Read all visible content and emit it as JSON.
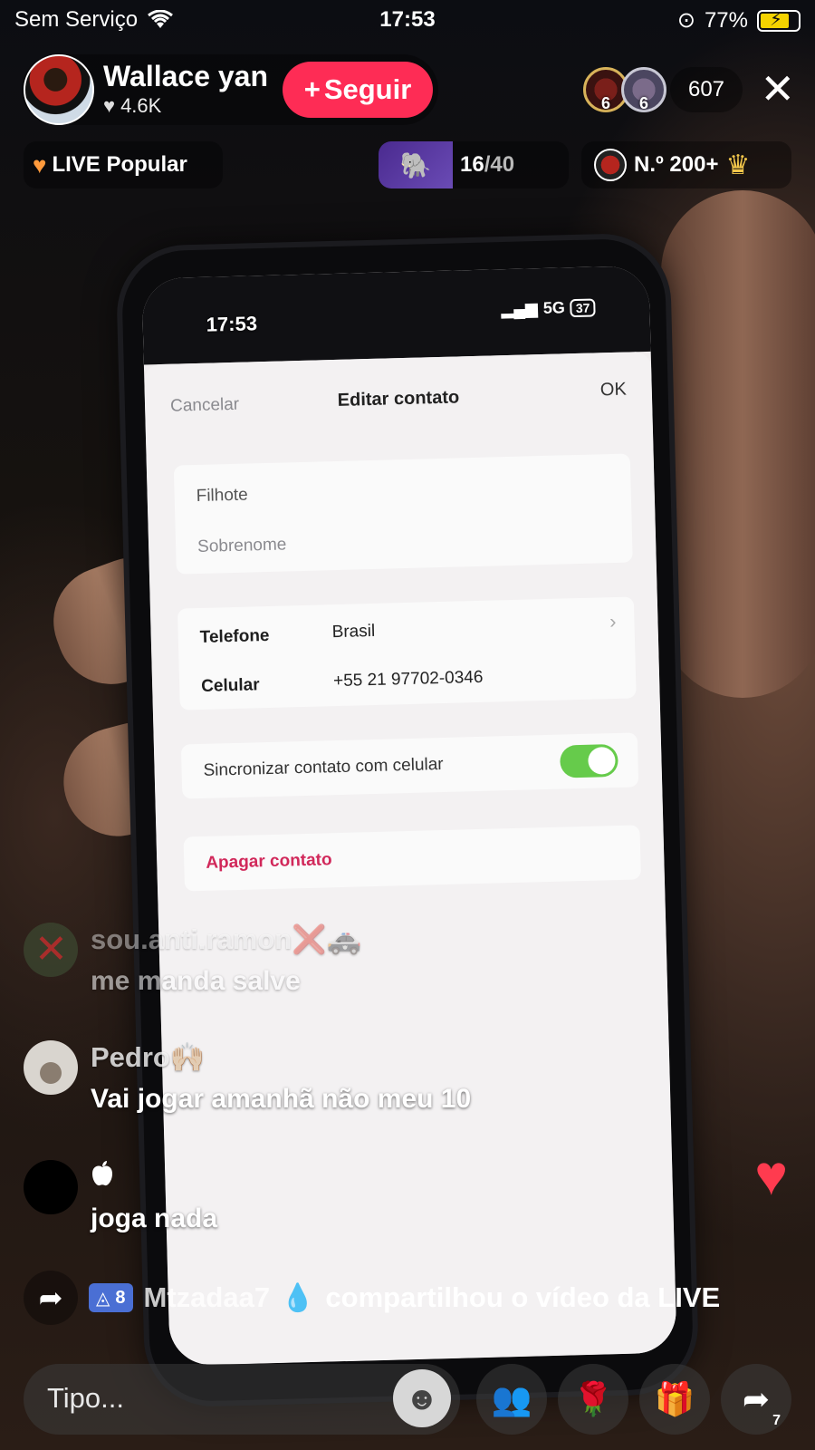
{
  "status_bar": {
    "carrier": "Sem Serviço",
    "time": "17:53",
    "battery": "77%"
  },
  "host": {
    "name": "Wallace yan",
    "likes": "4.6K",
    "follow_label": "Seguir"
  },
  "viewers": {
    "top1_rank": "6",
    "top2_rank": "6",
    "count": "607"
  },
  "badges": {
    "popular_label": "LIVE Popular",
    "goal_current": "16",
    "goal_total": "/40",
    "rank_label": "N.º 200+"
  },
  "video_phone": {
    "time": "17:53",
    "network": "5G",
    "battery": "37",
    "cancel": "Cancelar",
    "title": "Editar contato",
    "ok": "OK",
    "first_name": "Filhote",
    "last_name_placeholder": "Sobrenome",
    "phone_label": "Telefone",
    "phone_country": "Brasil",
    "mobile_label": "Celular",
    "mobile_number": "+55  21 97702-0346",
    "sync_label": "Sincronizar contato com celular",
    "sync_on": true,
    "delete_label": "Apagar contato"
  },
  "chat": [
    {
      "user": "sou.anti.ramon❌🚓",
      "message": "me manda salve"
    },
    {
      "user": "Pedro🙌🏻",
      "message": "Vai jogar amanhã não meu 10"
    },
    {
      "user": "",
      "message": "joga nada"
    }
  ],
  "share_event": {
    "level": "8",
    "user": "Mtzadaa7",
    "text": "compartilhou o vídeo da LIVE"
  },
  "bottom_bar": {
    "input_placeholder": "Tipo...",
    "share_count": "7"
  },
  "colors": {
    "follow": "#fe2c55",
    "toggle_on": "#66cb4b",
    "delete": "#d1285a",
    "heart": "#ff3b4f"
  }
}
